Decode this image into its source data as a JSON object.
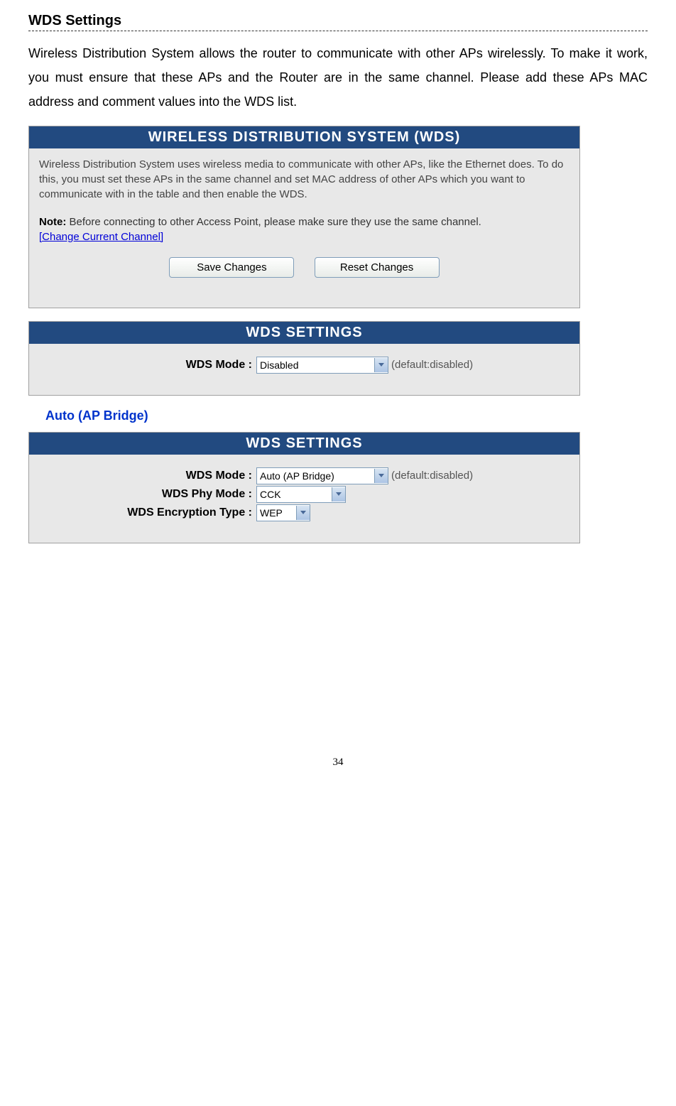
{
  "page": {
    "section_title": "WDS Settings",
    "intro_text": "Wireless Distribution System allows the router to communicate with other APs wirelessly. To make it work, you must ensure that these APs and the Router are in the same channel. Please add these APs MAC address and comment values into the WDS list.",
    "page_number": "34"
  },
  "panel1": {
    "header": "WIRELESS DISTRIBUTION SYSTEM (WDS)",
    "desc": "Wireless Distribution System uses wireless media to communicate with other APs, like the Ethernet does. To do this, you must set these APs in the same channel and set MAC address of other APs which you want to communicate with in the table and then enable the WDS.",
    "note_label": "Note:",
    "note_text": " Before connecting to other Access Point, please make sure they use the same channel.",
    "change_link": "[Change Current Channel]",
    "save_btn": "Save Changes",
    "reset_btn": "Reset Changes"
  },
  "panel2": {
    "header": "WDS SETTINGS",
    "mode_label": "WDS Mode :",
    "mode_value": "Disabled",
    "hint": "(default:disabled)"
  },
  "subhead": "Auto (AP Bridge)",
  "panel3": {
    "header": "WDS SETTINGS",
    "mode_label": "WDS Mode :",
    "mode_value": "Auto (AP Bridge)",
    "phy_label": "WDS Phy Mode :",
    "phy_value": "CCK",
    "enc_label": "WDS Encryption Type :",
    "enc_value": "WEP",
    "hint": "(default:disabled)"
  }
}
